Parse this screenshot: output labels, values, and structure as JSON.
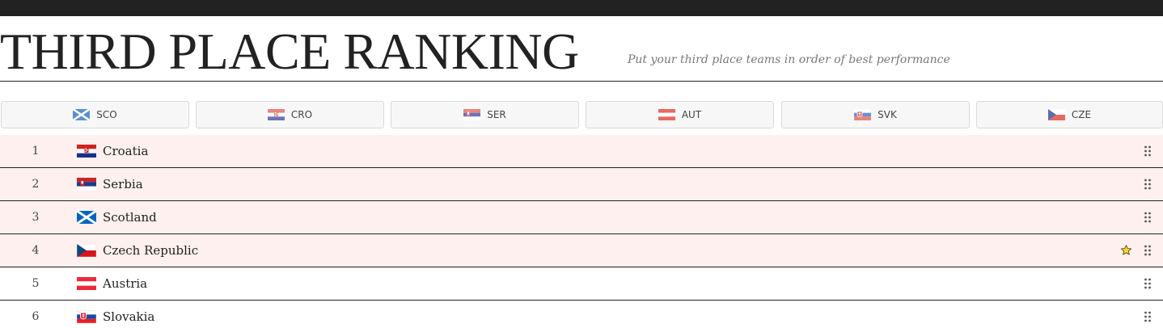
{
  "header": {
    "title": "THIRD PLACE RANKING",
    "subtitle": "Put your third place teams in order of best performance"
  },
  "colors": {
    "topbar": "#222222",
    "highlight_row": "#fdf0ee",
    "star": "#f2d43a"
  },
  "chips": [
    {
      "label": "SCO",
      "flag": "scotland-flag-icon"
    },
    {
      "label": "CRO",
      "flag": "croatia-flag-icon"
    },
    {
      "label": "SER",
      "flag": "serbia-flag-icon"
    },
    {
      "label": "AUT",
      "flag": "austria-flag-icon"
    },
    {
      "label": "SVK",
      "flag": "slovakia-flag-icon"
    },
    {
      "label": "CZE",
      "flag": "czech-flag-icon"
    }
  ],
  "rankings": [
    {
      "rank": "1",
      "team": "Croatia",
      "flag": "croatia-flag-icon",
      "highlighted": true,
      "starred": false
    },
    {
      "rank": "2",
      "team": "Serbia",
      "flag": "serbia-flag-icon",
      "highlighted": true,
      "starred": false
    },
    {
      "rank": "3",
      "team": "Scotland",
      "flag": "scotland-flag-icon",
      "highlighted": true,
      "starred": false
    },
    {
      "rank": "4",
      "team": "Czech Republic",
      "flag": "czech-flag-icon",
      "highlighted": true,
      "starred": true
    },
    {
      "rank": "5",
      "team": "Austria",
      "flag": "austria-flag-icon",
      "highlighted": false,
      "starred": false
    },
    {
      "rank": "6",
      "team": "Slovakia",
      "flag": "slovakia-flag-icon",
      "highlighted": false,
      "starred": false
    }
  ]
}
